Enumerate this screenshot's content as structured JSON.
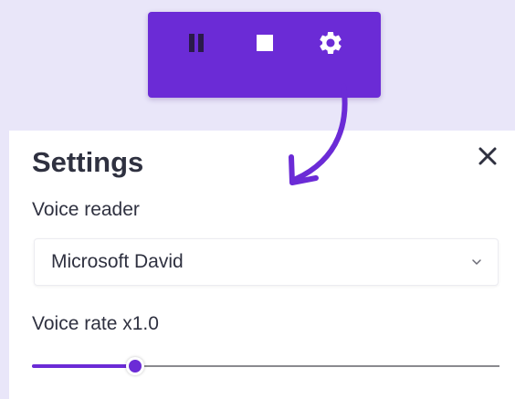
{
  "colors": {
    "accent": "#6b2bd6",
    "background": "#e9e6f9",
    "panel": "#ffffff",
    "text": "#2f3140"
  },
  "toolbar": {
    "pause_icon": "pause-icon",
    "stop_icon": "stop-icon",
    "settings_icon": "gear-icon"
  },
  "settings": {
    "title": "Settings",
    "close_icon": "close-icon",
    "voice_reader": {
      "label": "Voice reader",
      "value": "Microsoft David"
    },
    "voice_rate": {
      "label": "Voice rate x1.0",
      "value_fraction": 0.22
    }
  }
}
